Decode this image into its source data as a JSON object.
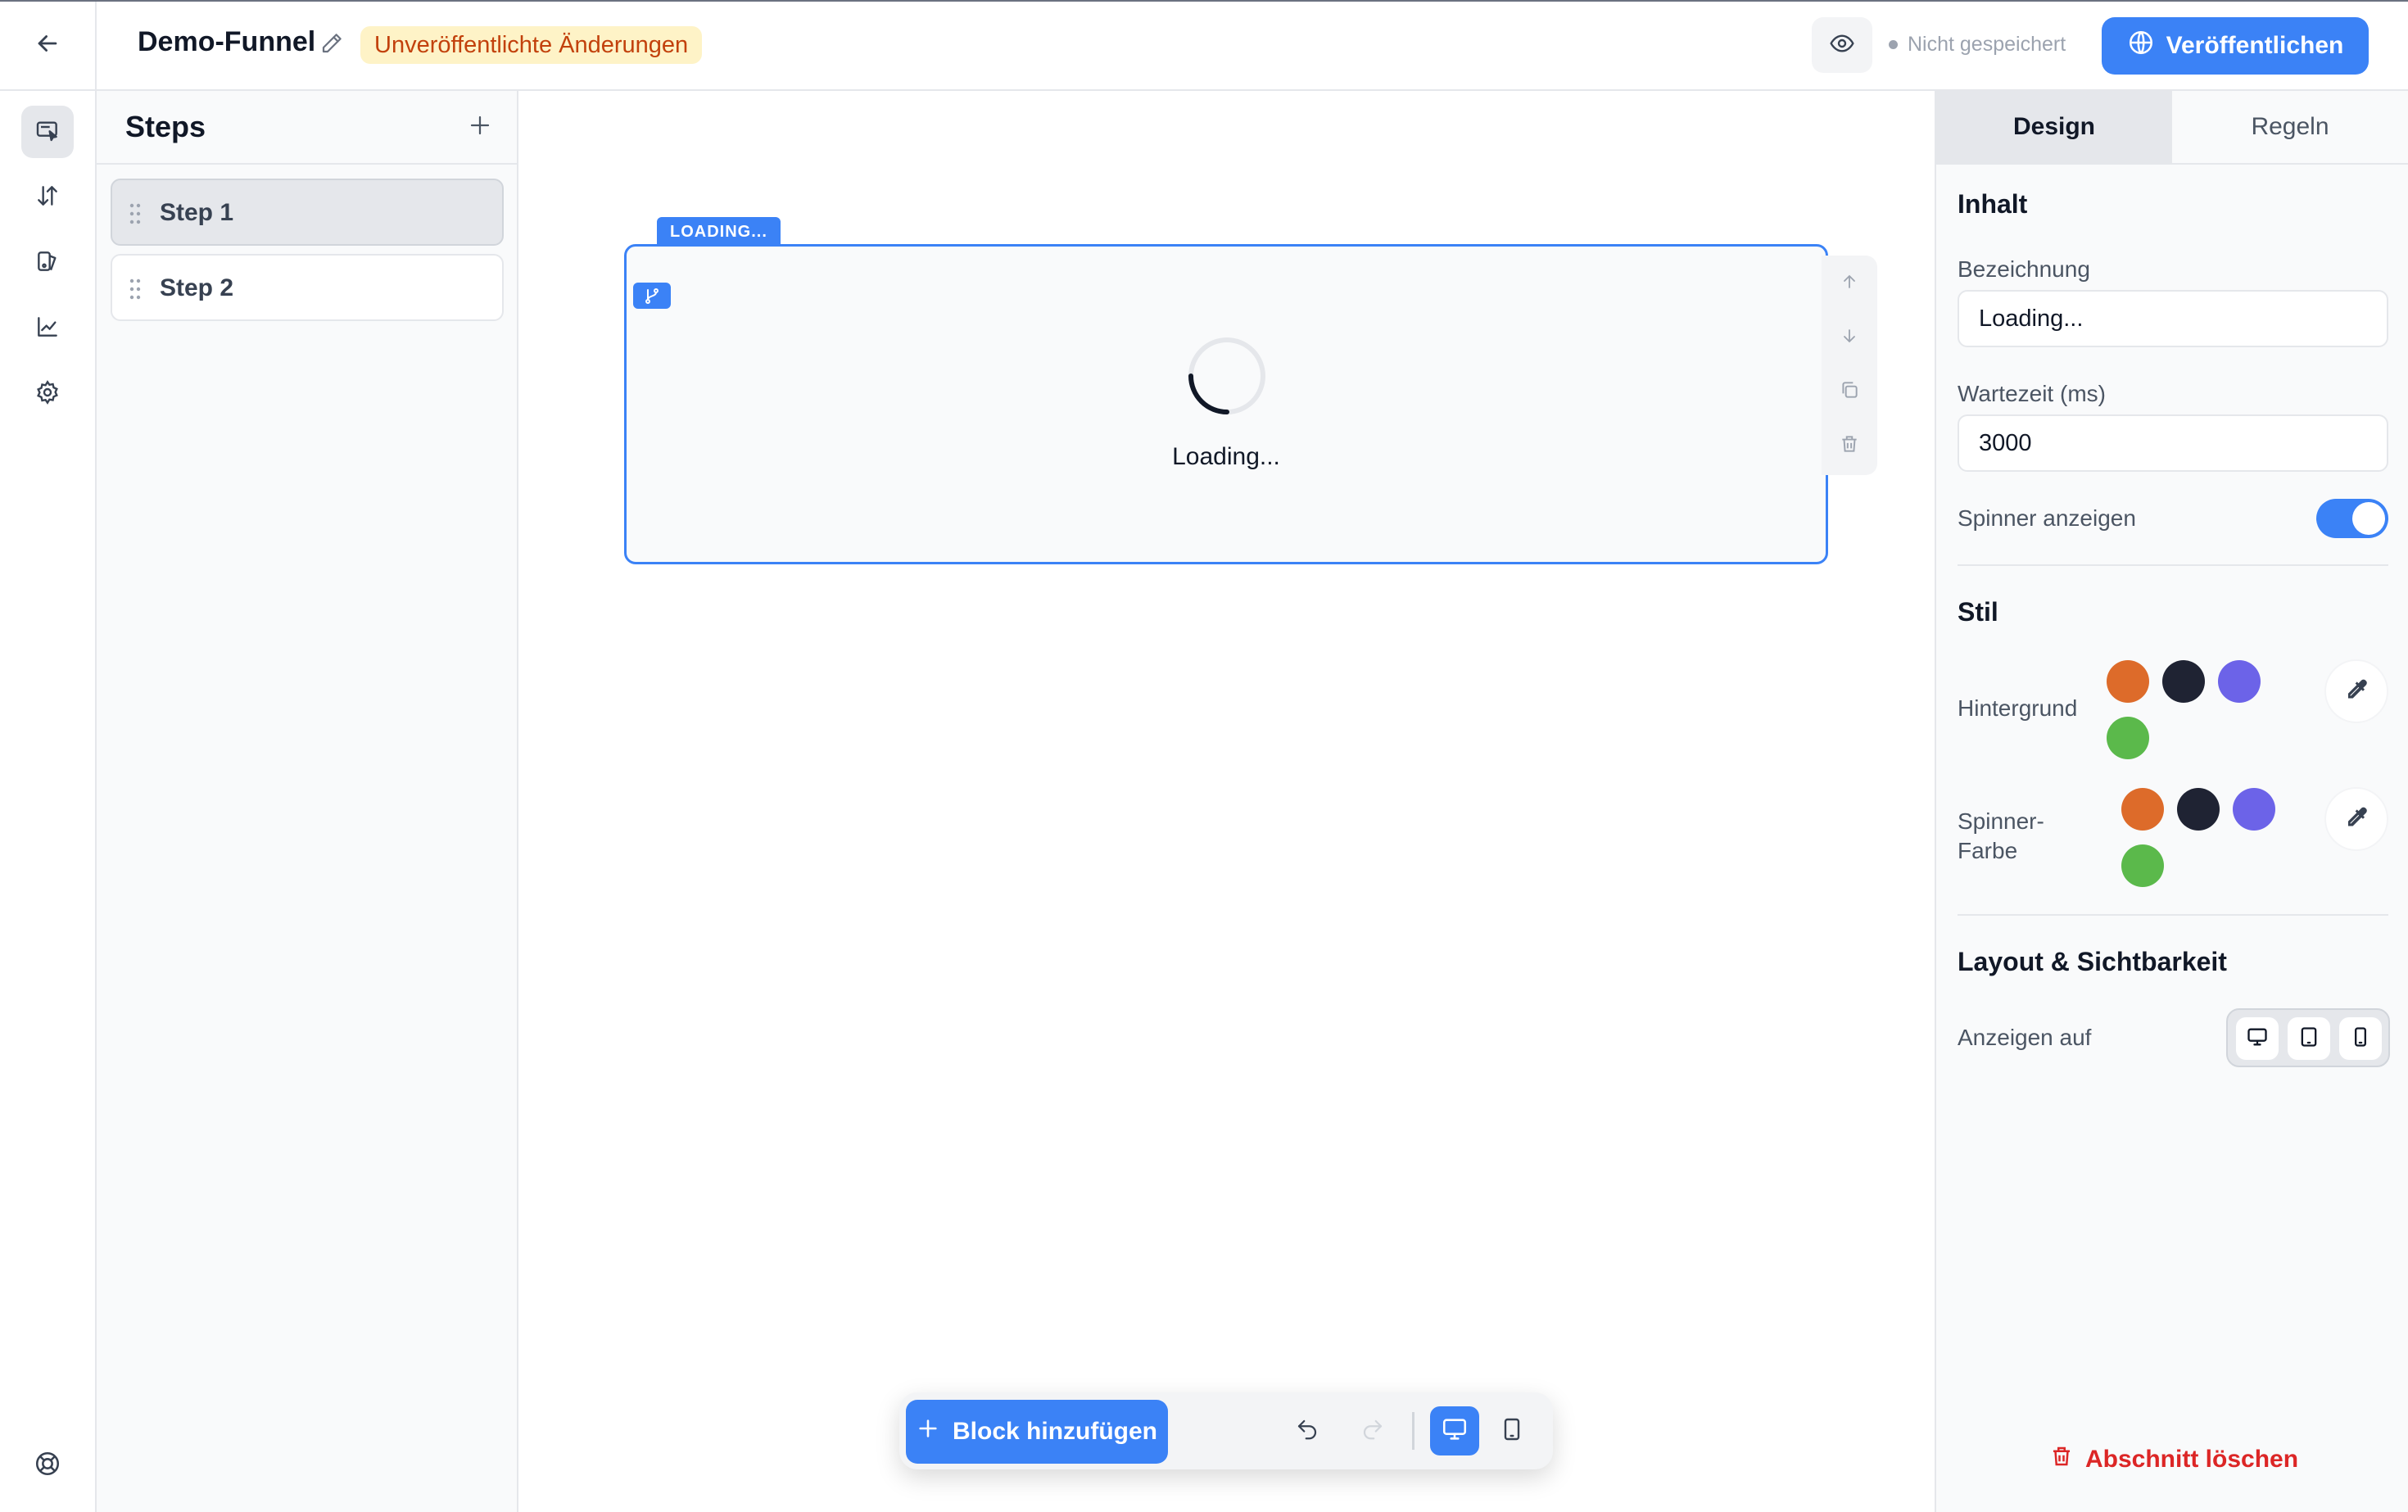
{
  "header": {
    "title": "Demo-Funnel",
    "unsaved_badge": "Unveröffentlichte Änderungen",
    "save_status": "Nicht gespeichert",
    "publish_label": "Veröffentlichen"
  },
  "rail": {
    "icons": [
      "editor-icon",
      "swap-vertical-icon",
      "theme-icon",
      "chart-icon",
      "settings-icon",
      "help-icon"
    ]
  },
  "steps_panel": {
    "title": "Steps",
    "items": [
      {
        "label": "Step 1",
        "active": true
      },
      {
        "label": "Step 2",
        "active": false
      }
    ]
  },
  "canvas": {
    "block_tag": "LOADING...",
    "block_text": "Loading..."
  },
  "toolbar": {
    "add_block_label": "Block hinzufügen",
    "view": "desktop"
  },
  "right_panel": {
    "tabs": [
      {
        "label": "Design",
        "active": true
      },
      {
        "label": "Regeln",
        "active": false
      }
    ],
    "content_section": "Inhalt",
    "label_field": {
      "label": "Bezeichnung",
      "value": "Loading..."
    },
    "wait_field": {
      "label": "Wartezeit (ms)",
      "value": "3000"
    },
    "spinner_toggle": {
      "label": "Spinner anzeigen",
      "on": true
    },
    "style_section": "Stil",
    "background": {
      "label": "Hintergrund",
      "colors": [
        "#dd6b2a",
        "#1f2333",
        "#6c63e8",
        "#5bb94b"
      ]
    },
    "spinner_color": {
      "label_line1": "Spinner-",
      "label_line2": "Farbe",
      "colors": [
        "#dd6b2a",
        "#1f2333",
        "#6c63e8",
        "#5bb94b"
      ]
    },
    "layout_section": "Layout & Sichtbarkeit",
    "show_on_label": "Anzeigen auf",
    "delete_section_label": "Abschnitt löschen"
  },
  "colors": {
    "accent": "#3b82f6",
    "badge_text": "#c2410c",
    "badge_bg": "#fef3c7",
    "danger": "#dc2626"
  }
}
